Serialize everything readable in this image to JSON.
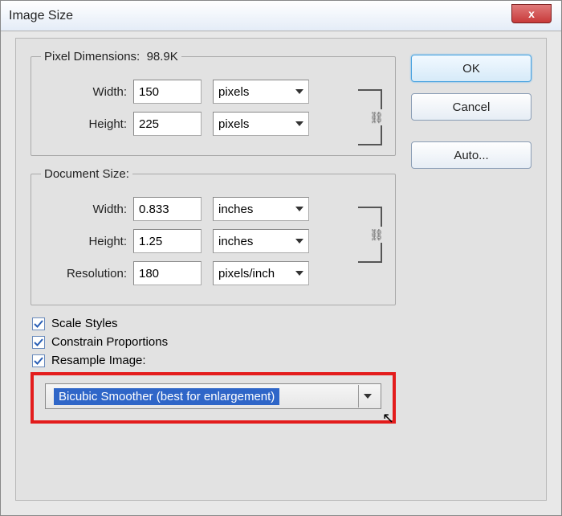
{
  "window": {
    "title": "Image Size",
    "close_x": "x"
  },
  "pixel_dimensions": {
    "legend_prefix": "Pixel Dimensions:",
    "size": "98.9K",
    "width_label": "Width:",
    "width_value": "150",
    "width_unit": "pixels",
    "height_label": "Height:",
    "height_value": "225",
    "height_unit": "pixels"
  },
  "document_size": {
    "legend": "Document Size:",
    "width_label": "Width:",
    "width_value": "0.833",
    "width_unit": "inches",
    "height_label": "Height:",
    "height_value": "1.25",
    "height_unit": "inches",
    "resolution_label": "Resolution:",
    "resolution_value": "180",
    "resolution_unit": "pixels/inch"
  },
  "checks": {
    "scale_styles": "Scale Styles",
    "constrain": "Constrain Proportions",
    "resample": "Resample Image:"
  },
  "resample_method": "Bicubic Smoother (best for enlargement)",
  "buttons": {
    "ok": "OK",
    "cancel": "Cancel",
    "auto": "Auto..."
  }
}
